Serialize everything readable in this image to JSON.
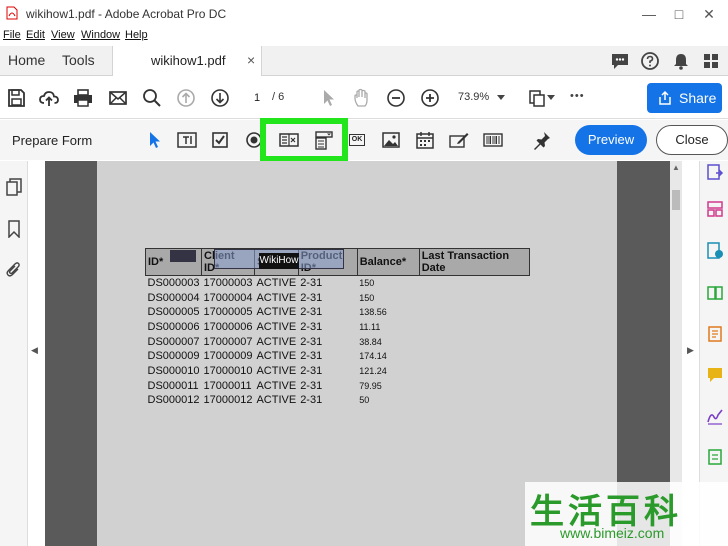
{
  "window": {
    "title": "wikihow1.pdf - Adobe Acrobat Pro DC"
  },
  "menu": [
    "File",
    "Edit",
    "View",
    "Window",
    "Help"
  ],
  "tabs": {
    "home": "Home",
    "tools": "Tools",
    "document": "wikihow1.pdf",
    "close_glyph": "×"
  },
  "toolbar": {
    "page_current": "1",
    "page_total": "/ 6",
    "zoom": "73.9%",
    "share_label": "Share",
    "more_glyph": "•••"
  },
  "prepare_form": {
    "title": "Prepare Form",
    "preview_label": "Preview",
    "close_label": "Close",
    "ok_label": "OK"
  },
  "table": {
    "headers": [
      "ID*",
      "Client ID*",
      "Status*",
      "Product ID*",
      "Balance*",
      "Last Transaction Date"
    ],
    "rows": [
      [
        "DS000003",
        "17000003",
        "ACTIVE",
        "2-31",
        "150"
      ],
      [
        "DS000004",
        "17000004",
        "ACTIVE",
        "2-31",
        "150"
      ],
      [
        "DS000005",
        "17000005",
        "ACTIVE",
        "2-31",
        "138.56"
      ],
      [
        "DS000006",
        "17000006",
        "ACTIVE",
        "2-31",
        "11.11"
      ],
      [
        "DS000007",
        "17000007",
        "ACTIVE",
        "2-31",
        "38.84"
      ],
      [
        "DS000009",
        "17000009",
        "ACTIVE",
        "2-31",
        "174.14"
      ],
      [
        "DS000010",
        "17000010",
        "ACTIVE",
        "2-31",
        "121.24"
      ],
      [
        "DS000011",
        "17000011",
        "ACTIVE",
        "2-31",
        "79.95"
      ],
      [
        "DS000012",
        "17000012",
        "ACTIVE",
        "2-31",
        "50"
      ]
    ],
    "field_tag": "WikiHow"
  },
  "watermark": {
    "chinese": "生活百科",
    "url": "www.bimeiz.com"
  },
  "colors": {
    "accent_blue": "#1473e6",
    "highlight_green": "#22e51b",
    "form_accent": "#9b2fae"
  }
}
